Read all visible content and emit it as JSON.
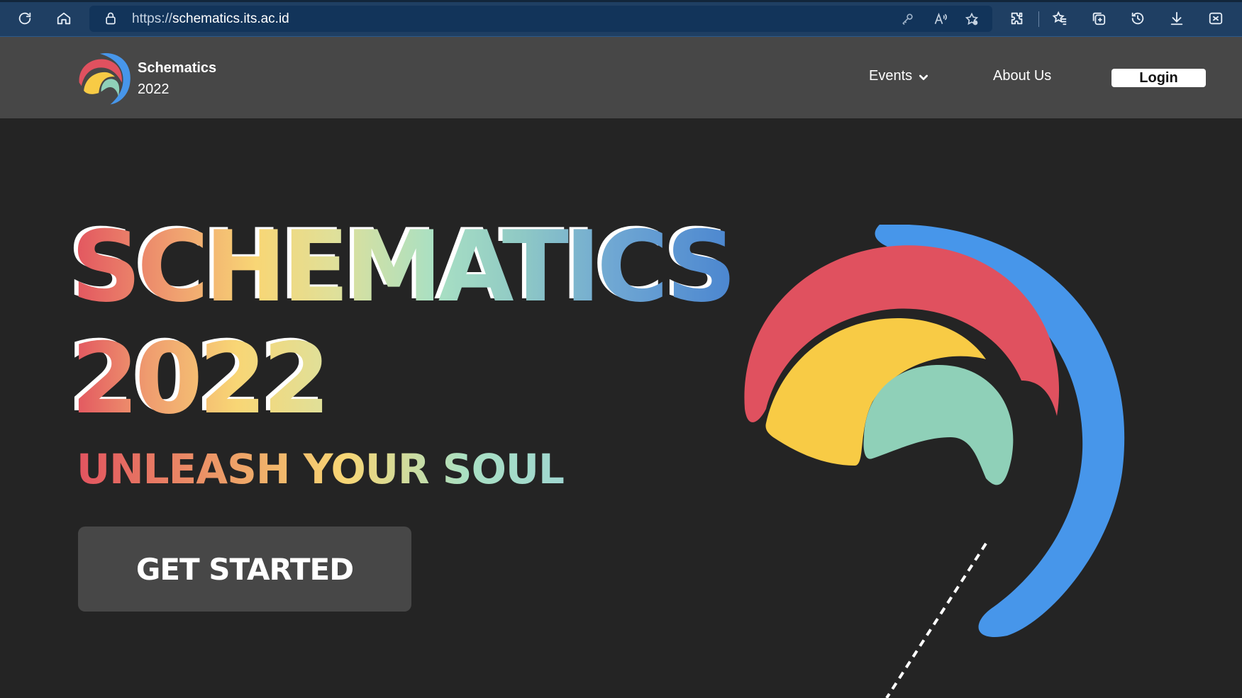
{
  "browser": {
    "url_protocol": "https://",
    "url_host": "schematics.its.ac.id",
    "icons": [
      "refresh-icon",
      "home-icon",
      "lock-icon",
      "key-icon",
      "read-aloud-icon",
      "add-favorite-icon",
      "extensions-icon",
      "favorites-icon",
      "collections-icon",
      "history-icon",
      "download-icon",
      "screenshot-icon"
    ]
  },
  "nav": {
    "brand_name": "Schematics",
    "brand_year": "2022",
    "events_label": "Events",
    "about_label": "About Us",
    "login_label": "Login"
  },
  "hero": {
    "title": "SCHEMATICS",
    "year": "2022",
    "tagline": "UNLEASH YOUR SOUL",
    "cta_label": "GET STARTED"
  },
  "colors": {
    "nav_bg": "#474747",
    "page_bg": "#242424",
    "browser_bg": "#1f3f63",
    "logo_red": "#e0515f",
    "logo_yellow": "#f8cb45",
    "logo_teal": "#8fd0b8",
    "logo_blue": "#4796ea"
  }
}
